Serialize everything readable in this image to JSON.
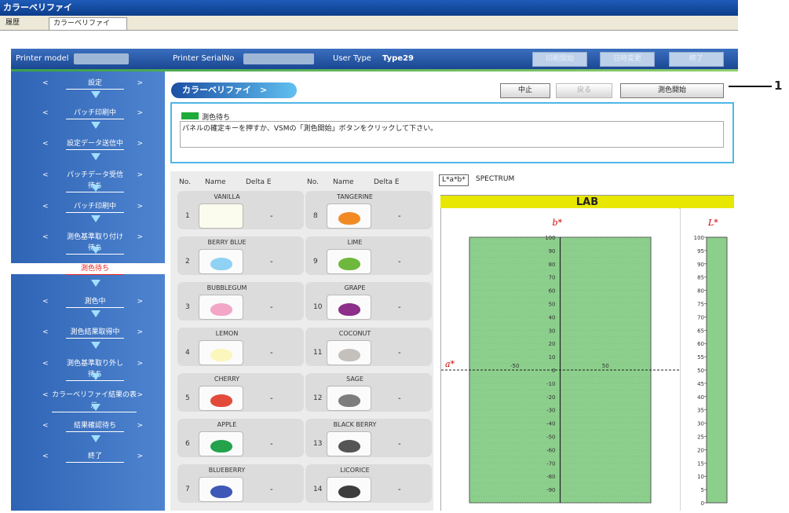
{
  "app": {
    "title": "カラーベリファイ"
  },
  "window_tabs": [
    {
      "label": "履歴"
    },
    {
      "label": "カラーベリファイ"
    }
  ],
  "header": {
    "printer_model_label": "Printer model",
    "printer_serial_label": "Printer SerialNo",
    "user_type_label": "User Type",
    "user_type_value": "Type29",
    "buttons": [
      "印刷開始",
      "日時変更",
      "終了"
    ]
  },
  "sidebar": {
    "items": [
      {
        "label": "設定",
        "state": "normal"
      },
      {
        "label": "パッチ印刷中",
        "state": "normal"
      },
      {
        "label": "設定データ送信中",
        "state": "normal"
      },
      {
        "label": "パッチデータ受信待ち",
        "state": "normal"
      },
      {
        "label": "パッチ印刷中",
        "state": "normal"
      },
      {
        "label": "測色基準取り付け待ち",
        "state": "normal"
      },
      {
        "label": "測色待ち",
        "state": "active"
      },
      {
        "label": "測色中",
        "state": "normal"
      },
      {
        "label": "測色結果取得中",
        "state": "normal"
      },
      {
        "label": "測色基準取り外し待ち",
        "state": "normal"
      },
      {
        "label": "カラーベリファイ結果の表示",
        "state": "normal"
      },
      {
        "label": "結果確認待ち",
        "state": "normal"
      },
      {
        "label": "終了",
        "state": "normal"
      }
    ]
  },
  "main": {
    "breadcrumb": "カラーベリファイ　>",
    "buttons": {
      "stop": "中止",
      "back": "戻る",
      "start_measure": "測色開始"
    },
    "status_title": "測色待ち",
    "status_message": "パネルの確定キーを押すか、VSMの「測色開始」ボタンをクリックして下さい。",
    "status_color": "#1faa3c",
    "callout_number": "1"
  },
  "table": {
    "headers": {
      "no": "No.",
      "name": "Name",
      "delta": "Delta E"
    },
    "rows": [
      {
        "no": "1",
        "name": "VANILLA",
        "color": "#fbfbee",
        "delta": "-"
      },
      {
        "no": "2",
        "name": "BERRY BLUE",
        "color": "#8fd2f3",
        "delta": "-"
      },
      {
        "no": "3",
        "name": "BUBBLEGUM",
        "color": "#f3a6c6",
        "delta": "-"
      },
      {
        "no": "4",
        "name": "LEMON",
        "color": "#fbf6bc",
        "delta": "-"
      },
      {
        "no": "5",
        "name": "CHERRY",
        "color": "#e24a3a",
        "delta": "-"
      },
      {
        "no": "6",
        "name": "APPLE",
        "color": "#24a24c",
        "delta": "-"
      },
      {
        "no": "7",
        "name": "BLUEBERRY",
        "color": "#3d58b6",
        "delta": "-"
      },
      {
        "no": "8",
        "name": "TANGERINE",
        "color": "#f28a24",
        "delta": "-"
      },
      {
        "no": "9",
        "name": "LIME",
        "color": "#6fb83e",
        "delta": "-"
      },
      {
        "no": "10",
        "name": "GRAPE",
        "color": "#8c2e8a",
        "delta": "-"
      },
      {
        "no": "11",
        "name": "COCONUT",
        "color": "#c4c0bb",
        "delta": "-"
      },
      {
        "no": "12",
        "name": "SAGE",
        "color": "#7d7d7d",
        "delta": "-"
      },
      {
        "no": "13",
        "name": "BLACK BERRY",
        "color": "#555555",
        "delta": "-"
      },
      {
        "no": "14",
        "name": "LICORICE",
        "color": "#3d3d3d",
        "delta": "-"
      }
    ]
  },
  "chart_tabs": [
    {
      "label": "L*a*b*"
    },
    {
      "label": "SPECTRUM"
    }
  ],
  "chart_data": {
    "type": "scatter",
    "title": "LAB",
    "plots": [
      {
        "id": "ab",
        "xlabel": "a*",
        "ylabel": "b*",
        "xlim": [
          -100,
          100
        ],
        "ylim": [
          -100,
          100
        ],
        "x_ticks": [
          "-50",
          "50"
        ],
        "y_ticks": [
          "100",
          "90",
          "80",
          "70",
          "60",
          "50",
          "40",
          "30",
          "20",
          "10",
          "0",
          "-10",
          "-20",
          "-30",
          "-40",
          "-50",
          "-60",
          "-70",
          "-80",
          "-90"
        ],
        "grid": true
      },
      {
        "id": "L",
        "ylabel": "L*",
        "ylim": [
          0,
          100
        ],
        "y_ticks": [
          "100",
          "95",
          "90",
          "85",
          "80",
          "75",
          "70",
          "65",
          "60",
          "55",
          "50",
          "45",
          "40",
          "35",
          "30",
          "25",
          "20",
          "15",
          "10",
          "5",
          "0"
        ],
        "grid": true
      }
    ],
    "points": []
  }
}
